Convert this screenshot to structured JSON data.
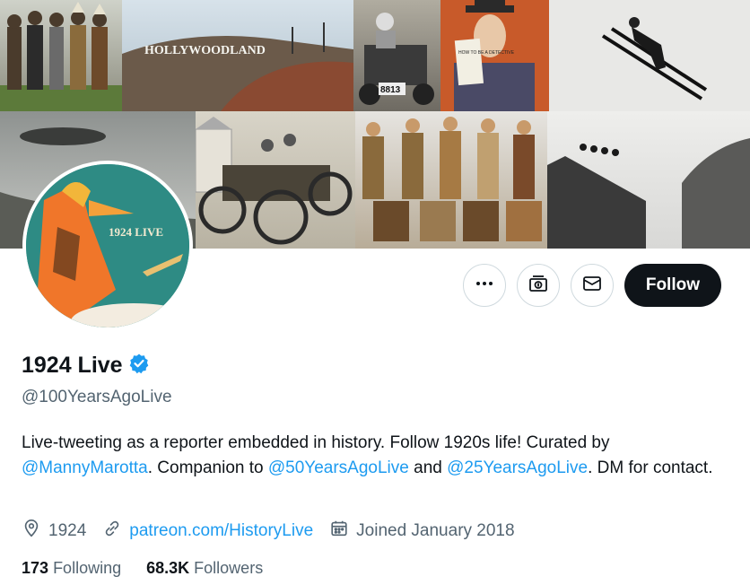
{
  "banner": {
    "photos": [
      "hollywoodland-sign",
      "native-american-group",
      "vintage-car",
      "buster-keaton",
      "ski-jumper",
      "zeppelin",
      "early-automobile",
      "expedition-team",
      "ski-jump-crowd"
    ],
    "sign_text": "HOLLYWOODLAND",
    "plate_text": "8813",
    "book_text": "HOW TO BE A DETECTIVE"
  },
  "avatar": {
    "poster_text": "1924 LIVE"
  },
  "actions": {
    "more_icon": "more-icon",
    "subscribe_icon": "subscribe-icon",
    "message_icon": "mail-icon",
    "follow_label": "Follow"
  },
  "profile": {
    "name": "1924 Live",
    "verified": true,
    "handle": "@100YearsAgoLive",
    "bio": {
      "part1": "Live-tweeting as a reporter embedded in history. Follow 1920s life! Curated by ",
      "mention1": "@MannyMarotta",
      "part2": ". Companion to ",
      "mention2": "@50YearsAgoLive",
      "part3": " and ",
      "mention3": "@25YearsAgoLive",
      "part4": ". DM for contact."
    },
    "location": "1924",
    "website": "patreon.com/HistoryLive",
    "joined": "Joined January 2018",
    "following_count": "173",
    "following_label": "Following",
    "followers_count": "68.3K",
    "followers_label": "Followers"
  },
  "colors": {
    "accent": "#1d9bf0",
    "text": "#0f1419",
    "muted": "#536471"
  }
}
